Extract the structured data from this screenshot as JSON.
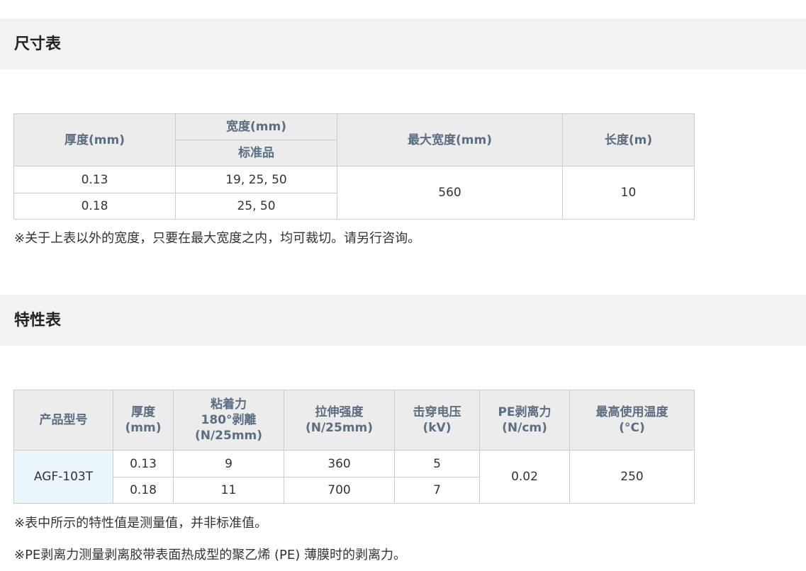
{
  "size_section": {
    "title": "尺寸表",
    "table": {
      "headers": {
        "thickness": "厚度(mm)",
        "width": "宽度(mm)",
        "width_sub": "标准品",
        "max_width": "最大宽度(mm)",
        "length": "长度(m)"
      },
      "rows": [
        {
          "thickness": "0.13",
          "width": "19, 25, 50"
        },
        {
          "thickness": "0.18",
          "width": "25, 50"
        }
      ],
      "max_width_value": "560",
      "length_value": "10"
    },
    "note": "※关于上表以外的宽度，只要在最大宽度之内，均可裁切。请另行咨询。"
  },
  "property_section": {
    "title": "特性表",
    "table": {
      "headers": {
        "model": "产品型号",
        "thickness_l1": "厚度",
        "thickness_l2": "(mm)",
        "adhesion_l1": "粘着力",
        "adhesion_l2": "180°剥離",
        "adhesion_l3": "(N/25mm)",
        "tensile_l1": "拉伸强度",
        "tensile_l2": "(N/25mm)",
        "breakdown_l1": "击穿电压",
        "breakdown_l2": "(kV)",
        "pe_peel_l1": "PE剥离力",
        "pe_peel_l2": "(N/cm)",
        "max_temp_l1": "最高使用温度",
        "max_temp_l2": "(°C)"
      },
      "model": "AGF-103T",
      "rows": [
        {
          "thickness": "0.13",
          "adhesion": "9",
          "tensile": "360",
          "breakdown": "5"
        },
        {
          "thickness": "0.18",
          "adhesion": "11",
          "tensile": "700",
          "breakdown": "7"
        }
      ],
      "pe_peel_value": "0.02",
      "max_temp_value": "250"
    },
    "notes": [
      "※表中所示的特性值是测量值，并非标准值。",
      "※PE剥离力测量剥离胶带表面热成型的聚乙烯 (PE) 薄膜时的剥离力。"
    ]
  }
}
